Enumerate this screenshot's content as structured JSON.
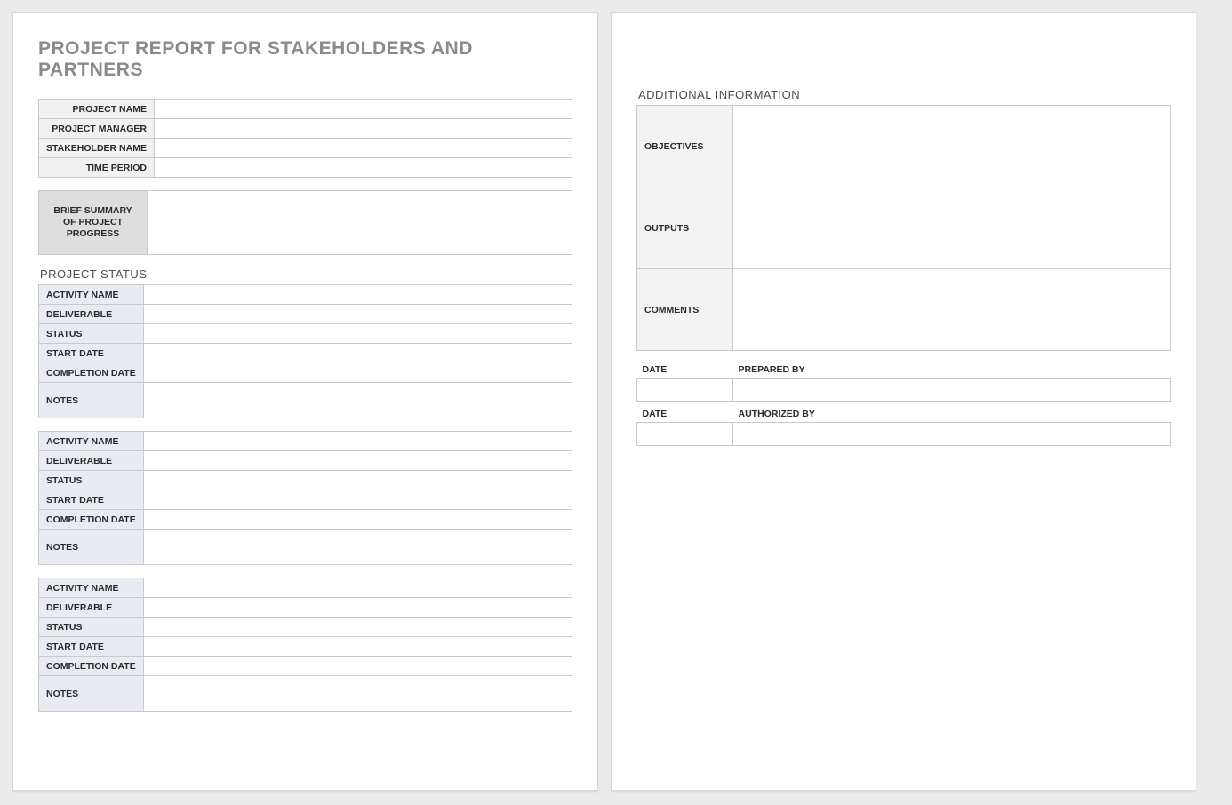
{
  "title": "PROJECT REPORT FOR STAKEHOLDERS AND PARTNERS",
  "headerLabels": {
    "projectName": "PROJECT NAME",
    "projectManager": "PROJECT MANAGER",
    "stakeholderName": "STAKEHOLDER NAME",
    "timePeriod": "TIME PERIOD"
  },
  "headerValues": {
    "projectName": "",
    "projectManager": "",
    "stakeholderName": "",
    "timePeriod": ""
  },
  "summaryLabel": "BRIEF SUMMARY OF PROJECT PROGRESS",
  "summaryValue": "",
  "statusHeader": "PROJECT STATUS",
  "activityLabels": {
    "activityName": "ACTIVITY NAME",
    "deliverable": "DELIVERABLE",
    "status": "STATUS",
    "startDate": "START DATE",
    "completionDate": "COMPLETION DATE",
    "notes": "NOTES"
  },
  "activities": [
    {
      "activityName": "",
      "deliverable": "",
      "status": "",
      "startDate": "",
      "completionDate": "",
      "notes": ""
    },
    {
      "activityName": "",
      "deliverable": "",
      "status": "",
      "startDate": "",
      "completionDate": "",
      "notes": ""
    },
    {
      "activityName": "",
      "deliverable": "",
      "status": "",
      "startDate": "",
      "completionDate": "",
      "notes": ""
    }
  ],
  "page2": {
    "additionalHeader": "ADDITIONAL INFORMATION",
    "labels": {
      "objectives": "OBJECTIVES",
      "outputs": "OUTPUTS",
      "comments": "COMMENTS",
      "date": "DATE",
      "preparedBy": "PREPARED BY",
      "authorizedBy": "AUTHORIZED BY"
    },
    "values": {
      "objectives": "",
      "outputs": "",
      "comments": "",
      "preparedDate": "",
      "preparedBy": "",
      "authorizedDate": "",
      "authorizedBy": ""
    }
  }
}
